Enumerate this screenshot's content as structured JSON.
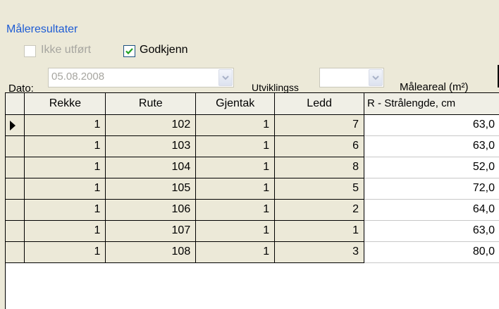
{
  "group": {
    "title": "Måleresultater"
  },
  "checkboxes": {
    "ikke_utfort": {
      "label": "Ikke utført",
      "checked": false,
      "enabled": false
    },
    "godkjenn": {
      "label": "Godkjenn",
      "checked": true,
      "enabled": true
    }
  },
  "fields": {
    "dato_label": "Dato:",
    "dato_value": "05.08.2008",
    "utviklingsstadium_label": "Utviklingss",
    "utviklingsstadium_value": "",
    "maleareal_label": "Måleareal (m²)"
  },
  "table": {
    "columns": [
      "Rekke",
      "Rute",
      "Gjentak",
      "Ledd",
      "R - Strålengde, cm"
    ],
    "rows": [
      [
        "1",
        "102",
        "1",
        "7",
        "63,0"
      ],
      [
        "1",
        "103",
        "1",
        "6",
        "63,0"
      ],
      [
        "1",
        "104",
        "1",
        "8",
        "52,0"
      ],
      [
        "1",
        "105",
        "1",
        "5",
        "72,0"
      ],
      [
        "1",
        "106",
        "1",
        "2",
        "64,0"
      ],
      [
        "1",
        "107",
        "1",
        "1",
        "63,0"
      ],
      [
        "1",
        "108",
        "1",
        "3",
        "80,0"
      ]
    ],
    "current_row": 0
  },
  "colors": {
    "group_title": "#1e5cd4",
    "checkmark": "#21a121"
  }
}
